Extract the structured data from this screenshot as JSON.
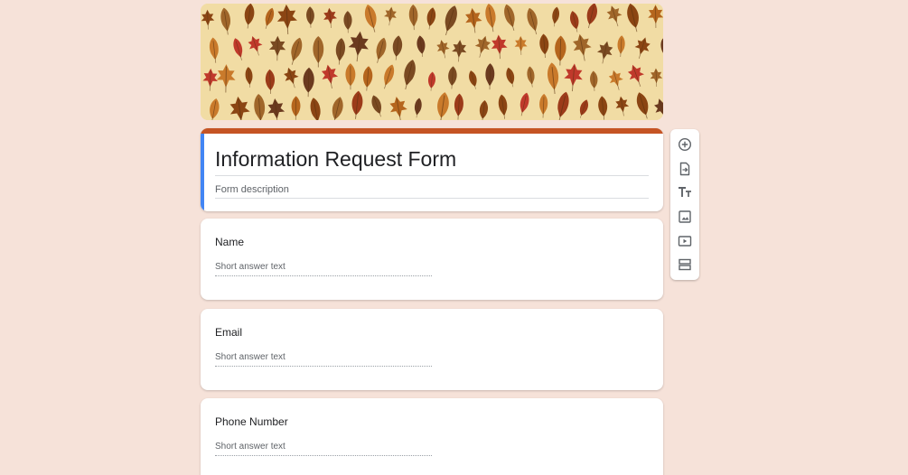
{
  "form": {
    "title": "Information Request Form",
    "description_placeholder": "Form description",
    "header_image": "autumn-leaves-pattern",
    "theme_color": "#c55424",
    "accent_color": "#4285f4",
    "background_color": "#f6e2d9"
  },
  "questions": [
    {
      "label": "Name",
      "answer_placeholder": "Short answer text"
    },
    {
      "label": "Email",
      "answer_placeholder": "Short answer text"
    },
    {
      "label": "Phone Number",
      "answer_placeholder": "Short answer text"
    }
  ],
  "toolbar": {
    "items": [
      {
        "icon": "add-circle-icon"
      },
      {
        "icon": "import-questions-icon"
      },
      {
        "icon": "title-text-icon"
      },
      {
        "icon": "image-icon"
      },
      {
        "icon": "video-icon"
      },
      {
        "icon": "section-icon"
      }
    ]
  }
}
